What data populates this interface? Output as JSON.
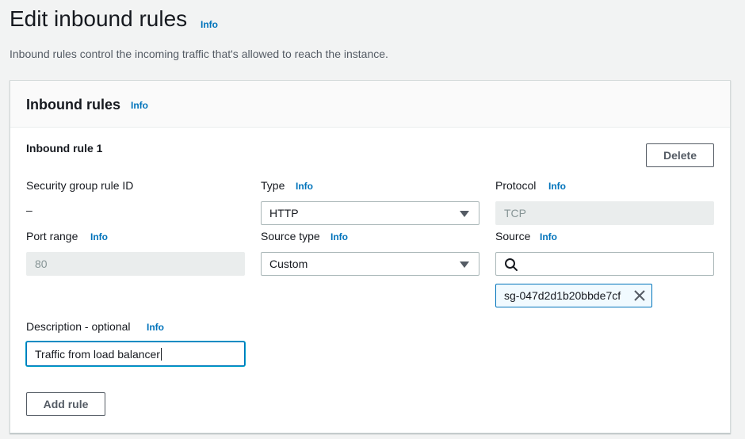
{
  "page": {
    "title": "Edit inbound rules",
    "info": "Info",
    "description": "Inbound rules control the incoming traffic that's allowed to reach the instance."
  },
  "panel": {
    "title": "Inbound rules",
    "info": "Info"
  },
  "rule": {
    "title": "Inbound rule 1",
    "delete_label": "Delete",
    "security_group_rule_id": {
      "label": "Security group rule ID",
      "value": "–"
    },
    "type": {
      "label": "Type",
      "info": "Info",
      "value": "HTTP"
    },
    "protocol": {
      "label": "Protocol",
      "info": "Info",
      "value": "TCP"
    },
    "port_range": {
      "label": "Port range",
      "info": "Info",
      "value": "80"
    },
    "source_type": {
      "label": "Source type",
      "info": "Info",
      "value": "Custom"
    },
    "source": {
      "label": "Source",
      "info": "Info",
      "search_value": "",
      "token": "sg-047d2d1b20bbde7cf"
    },
    "description": {
      "label": "Description - optional",
      "info": "Info",
      "value": "Traffic from load balancer"
    }
  },
  "add_rule_label": "Add rule",
  "icons": [
    "search-icon",
    "close-icon",
    "caret-down-icon"
  ],
  "colors": {
    "link": "#0073bb",
    "background": "#f2f3f3",
    "token_border": "#0073bb"
  }
}
